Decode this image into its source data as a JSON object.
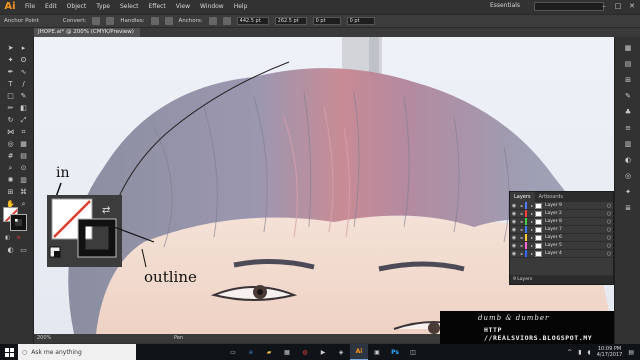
{
  "app": {
    "logo": "Ai"
  },
  "menu": [
    "File",
    "Edit",
    "Object",
    "Type",
    "Select",
    "Effect",
    "View",
    "Window",
    "Help"
  ],
  "workspace": "Essentials",
  "control_bar": {
    "tool_name": "Anchor Point",
    "convert_label": "Convert:",
    "handles_label": "Handles:",
    "anchors_label": "Anchors:",
    "x_value": "442.5 pt",
    "y_value": "262.5 pt",
    "w_value": "0 pt",
    "h_value": "0 pt"
  },
  "document_tab": {
    "title": "JHOPE.ai* @ 200% (CMYK/Preview)"
  },
  "annotations": {
    "in_label": "in",
    "outline_label": "outline"
  },
  "layers_panel": {
    "tabs": [
      "Layers",
      "Artboards"
    ],
    "layers": [
      {
        "name": "Layer 9",
        "color": "#4f7fff"
      },
      {
        "name": "Layer 2",
        "color": "#ff3a3a"
      },
      {
        "name": "Layer 8",
        "color": "#44cc44"
      },
      {
        "name": "Layer 7",
        "color": "#3a7bff"
      },
      {
        "name": "Layer 6",
        "color": "#ffcc33"
      },
      {
        "name": "Layer 5",
        "color": "#ff66cc"
      },
      {
        "name": "Layer 4",
        "color": "#3366ff"
      }
    ],
    "footer": "9 Layers"
  },
  "status": {
    "zoom": "200%",
    "tool": "Pen"
  },
  "watermark": {
    "script": "dumb & dumber",
    "url": "HTTP //REALSVIORS.BLOGSPOT.MY"
  },
  "taskbar": {
    "search_placeholder": "Ask me anything",
    "time": "10:09 PM",
    "date": "4/17/2017"
  },
  "colors": {
    "ai_orange": "#f7941d",
    "panel_bg": "#323232",
    "selection_red": "#e03a2e"
  }
}
